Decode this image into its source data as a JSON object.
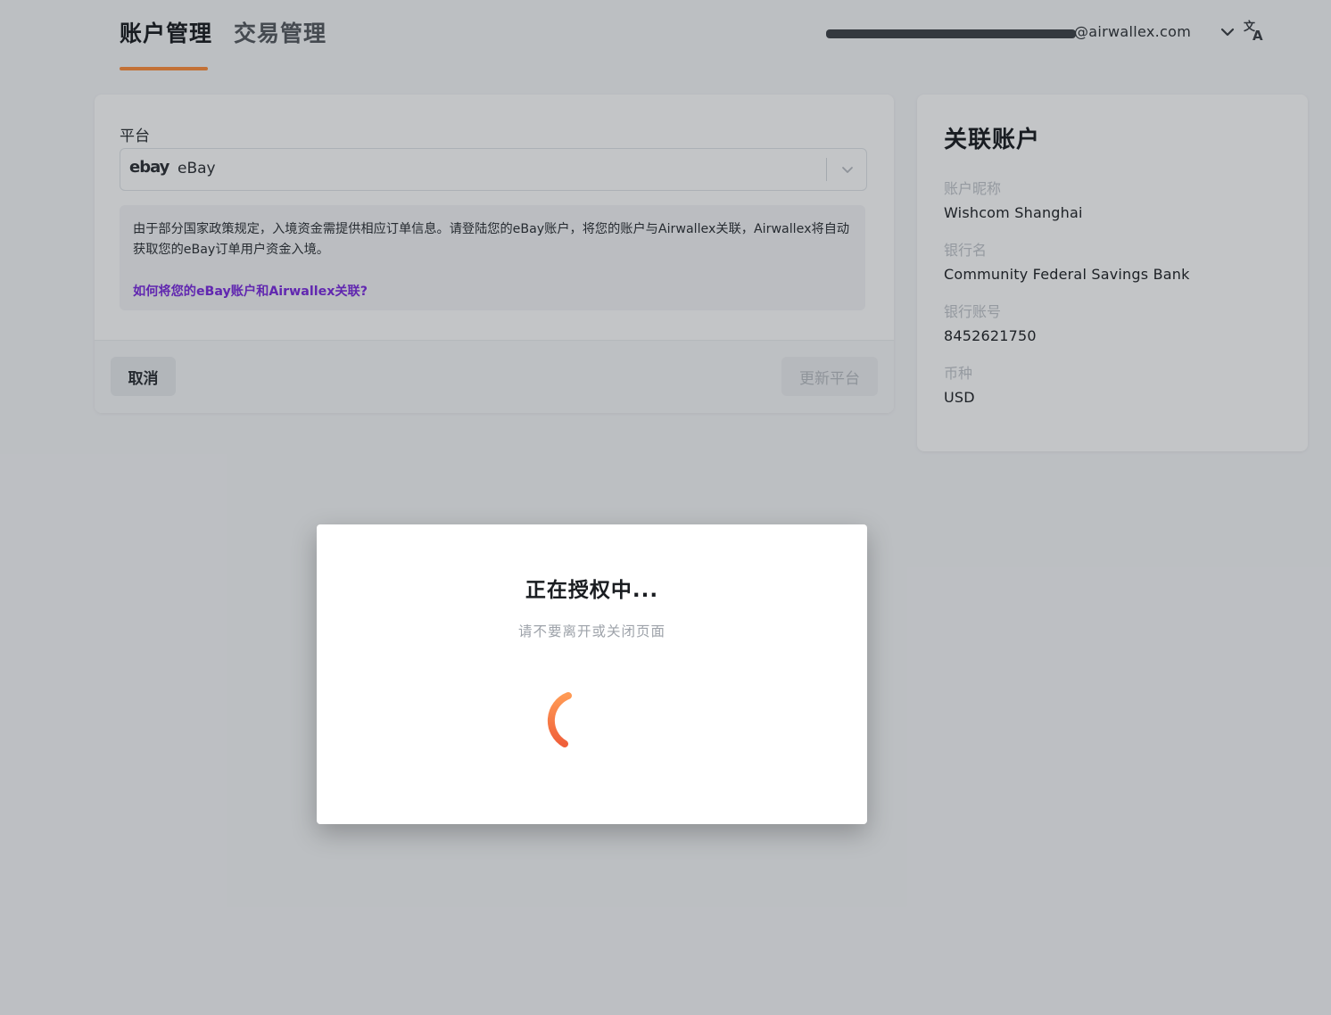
{
  "header": {
    "tabs": [
      {
        "label": "账户管理",
        "active": true
      },
      {
        "label": "交易管理",
        "active": false
      }
    ],
    "user_email_visible": "@airwallex.com",
    "chevron_icon": "chevron-down-icon",
    "language_icon": "translate-icon",
    "accent_color": "#ff8e3c"
  },
  "platform_form": {
    "label": "平台",
    "select": {
      "logo_text": "ebay",
      "value": "eBay"
    },
    "notice": {
      "text": "由于部分国家政策规定，入境资金需提供相应订单信息。请登陆您的eBay账户，将您的账户与Airwallex关联，Airwallex将自动获取您的eBay订单用户资金入境。",
      "link": "如何将您的eBay账户和Airwallex关联?",
      "link_color": "#7b2be0"
    },
    "buttons": {
      "cancel": "取消",
      "update": "更新平台"
    }
  },
  "linked_account": {
    "title": "关联账户",
    "fields": [
      {
        "label": "账户昵称",
        "value": "Wishcom Shanghai"
      },
      {
        "label": "银行名",
        "value": "Community Federal Savings Bank"
      },
      {
        "label": "银行账号",
        "value": "8452621750"
      },
      {
        "label": "币种",
        "value": "USD"
      }
    ]
  },
  "modal": {
    "title": "正在授权中...",
    "subtitle": "请不要离开或关闭页面",
    "spinner_color": "#f07a3c"
  }
}
